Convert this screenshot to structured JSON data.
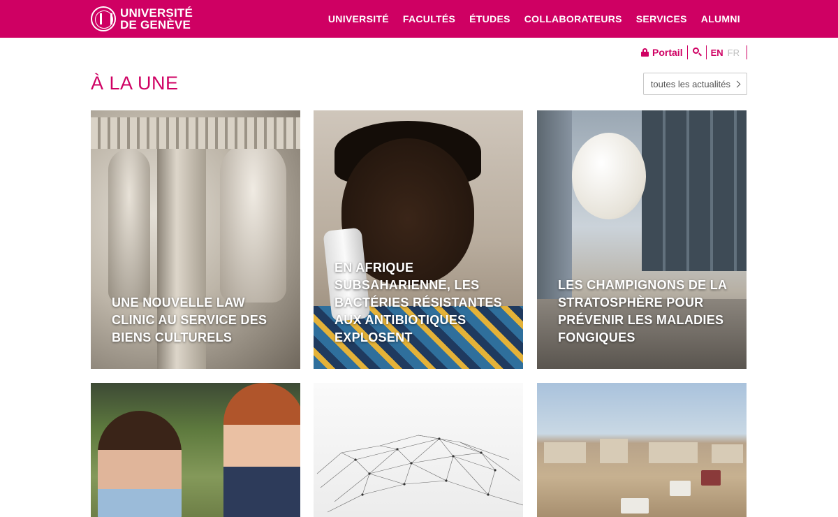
{
  "header": {
    "logo_line1": "UNIVERSITÉ",
    "logo_line2": "DE GENÈVE",
    "nav": [
      "UNIVERSITÉ",
      "FACULTÉS",
      "ÉTUDES",
      "COLLABORATEURS",
      "SERVICES",
      "ALUMNI"
    ]
  },
  "utility": {
    "portal_label": "Portail",
    "lang_active": "EN",
    "lang_other": "FR"
  },
  "section": {
    "title": "À LA UNE",
    "all_news_label": "toutes les actualités"
  },
  "cards": [
    {
      "caption": "UNE NOUVELLE LAW CLINIC AU SERVICE DES BIENS CULTURELS"
    },
    {
      "caption": "EN AFRIQUE SUBSAHARIENNE, LES BACTÉRIES RÉSISTANTES AUX ANTIBIOTIQUES EXPLOSENT"
    },
    {
      "caption": "LES CHAMPIGNONS DE LA STRATOSPHÈRE POUR PRÉVENIR LES MALADIES FONGIQUES"
    },
    {
      "caption": ""
    },
    {
      "caption": ""
    },
    {
      "caption": ""
    }
  ],
  "colors": {
    "brand": "#cf0063",
    "inactive_lang": "#bdbdbd"
  },
  "icons": [
    "university-seal-icon",
    "lock-icon",
    "search-icon",
    "chevron-right-icon"
  ]
}
